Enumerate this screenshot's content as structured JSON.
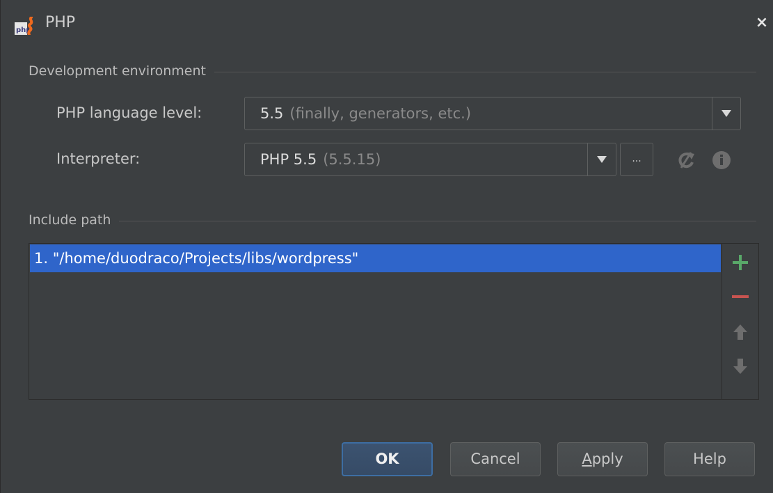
{
  "window": {
    "title": "PHP",
    "close_label": "×"
  },
  "dev_env": {
    "group_title": "Development environment",
    "language_level": {
      "label": "PHP language level:",
      "value": "5.5",
      "hint": "(finally, generators, etc.)"
    },
    "interpreter": {
      "label": "Interpreter:",
      "value": "PHP 5.5",
      "hint": "(5.5.15)",
      "browse_label": "..."
    }
  },
  "include_path": {
    "group_title": "Include path",
    "items": [
      "1. \"/home/duodraco/Projects/libs/wordpress\""
    ]
  },
  "buttons": {
    "ok": "OK",
    "cancel": "Cancel",
    "apply_mnemonic": "A",
    "apply_rest": "pply",
    "help": "Help"
  },
  "colors": {
    "background": "#3c3f41",
    "selection": "#2f65ca",
    "add_icon": "#59a869",
    "remove_icon": "#c75450"
  }
}
